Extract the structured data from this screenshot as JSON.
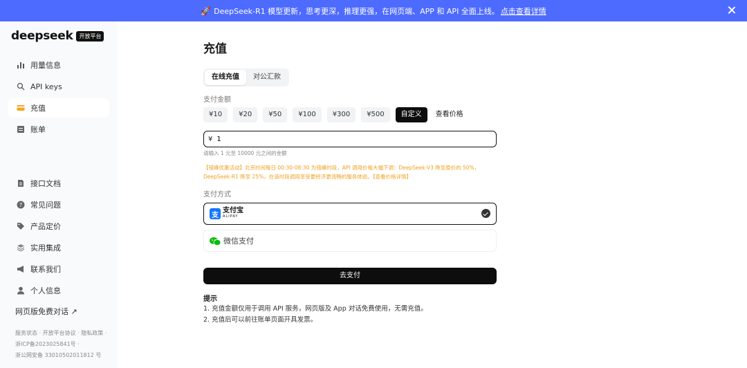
{
  "banner": {
    "icon": "rocket-icon",
    "text": "DeepSeek-R1 模型更新，思考更深，推理更强，在网页端、APP 和 API 全面上线。",
    "link": "点击查看详情",
    "color": "#4d6bfe"
  },
  "sidebar": {
    "logo": "deepseek",
    "badge": "开放平台",
    "nav_top": [
      {
        "label": "用量信息",
        "icon": "bar-chart-icon"
      },
      {
        "label": "API keys",
        "icon": "search-icon"
      },
      {
        "label": "充值",
        "icon": "wallet-icon",
        "active": true
      },
      {
        "label": "账单",
        "icon": "bill-icon"
      }
    ],
    "nav_bottom": [
      {
        "label": "接口文档",
        "icon": "document-icon"
      },
      {
        "label": "常见问题",
        "icon": "question-icon"
      },
      {
        "label": "产品定价",
        "icon": "tag-icon"
      },
      {
        "label": "实用集成",
        "icon": "layers-icon"
      },
      {
        "label": "联系我们",
        "icon": "megaphone-icon"
      },
      {
        "label": "个人信息",
        "icon": "user-icon"
      }
    ],
    "web_chat": "网页版免费对话",
    "footer": {
      "status": "服务状态",
      "agreement": "开放平台协议",
      "privacy": "隐私政策",
      "icp": "浙ICP备2023025841号",
      "security": "浙公网安备 33010502011812 号"
    }
  },
  "main": {
    "title": "充值",
    "tabs": [
      "在线充值",
      "对公汇款"
    ],
    "amount_label": "支付金额",
    "amounts": [
      "¥10",
      "¥20",
      "¥50",
      "¥100",
      "¥300",
      "¥500"
    ],
    "custom": "自定义",
    "view_price": "查看价格",
    "currency": "¥",
    "input_value": "1",
    "hint": "请输入 1 元至 10000 元之间的金额",
    "promo_text": "【错峰优惠活动】北京时间每日 00:30-08:30 为错峰时段，API 调用价格大幅下调：DeepSeek-V3 降至原价的 50%，DeepSeek-R1 降至 25%，在该时段调用享受更经济更流畅的服务体验。",
    "promo_link": "【查看价格详情】",
    "payment_label": "支付方式",
    "alipay_cn": "支付宝",
    "alipay_en": "ALIPAY",
    "wechat": "微信支付",
    "pay_button": "去支付",
    "tips_title": "提示",
    "tips": [
      "1. 充值金额仅用于调用 API 服务，网页版及 App 对话免费使用，无需充值。",
      "2. 充值后可以前往账单页面开具发票。"
    ]
  }
}
